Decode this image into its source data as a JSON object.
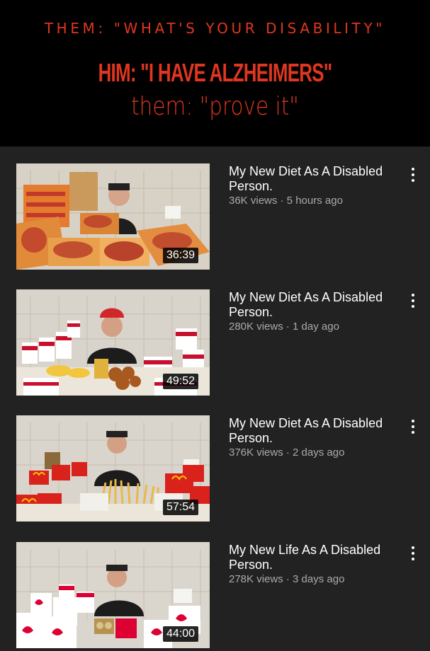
{
  "meme": {
    "line1": "THEM: \"WHAT'S YOUR DISABILITY\"",
    "line2": "HIM: \"I HAVE ALZHEIMERS\"",
    "line3": "them: \"prove it\""
  },
  "colors": {
    "accent": "#e0361f",
    "feed_bg": "#222222",
    "meta": "#aaaaaa"
  },
  "videos": [
    {
      "title": "My New Diet As A Disabled Person.",
      "meta": "36K views · 5 hours ago",
      "duration": "36:39",
      "scene": "pizza"
    },
    {
      "title": "My New Diet As A Disabled Person.",
      "meta": "280K views · 1 day ago",
      "duration": "49:52",
      "scene": "kfc"
    },
    {
      "title": "My New Diet As A Disabled Person.",
      "meta": "376K views · 2 days ago",
      "duration": "57:54",
      "scene": "mcdonalds"
    },
    {
      "title": "My New Life As A Disabled Person.",
      "meta": "278K views · 3 days ago",
      "duration": "44:00",
      "scene": "chickfila"
    }
  ]
}
